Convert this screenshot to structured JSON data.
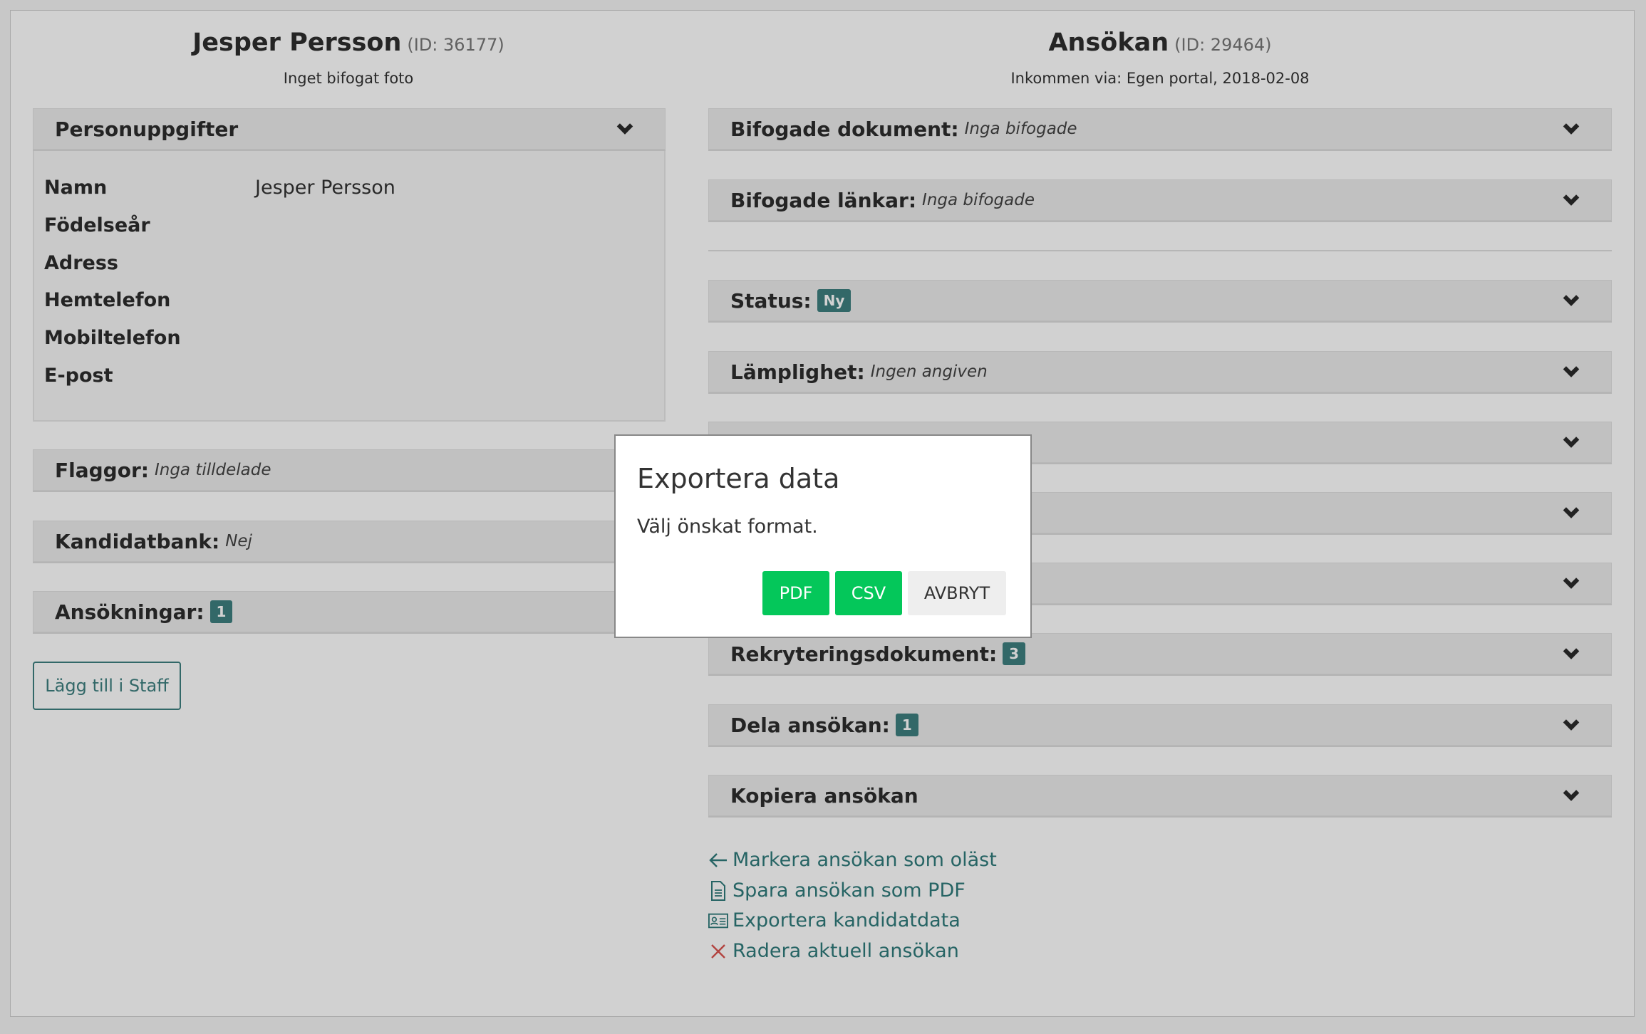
{
  "candidate": {
    "name": "Jesper Persson",
    "id": "(ID: 36177)",
    "photo_note": "Inget bifogat foto"
  },
  "personal": {
    "title": "Personuppgifter",
    "fields": [
      {
        "label": "Namn",
        "value": "Jesper Persson"
      },
      {
        "label": "Födelseår",
        "value": ""
      },
      {
        "label": "Adress",
        "value": ""
      },
      {
        "label": "Hemtelefon",
        "value": ""
      },
      {
        "label": "Mobiltelefon",
        "value": ""
      },
      {
        "label": "E-post",
        "value": ""
      }
    ]
  },
  "left_sections": {
    "flags": {
      "label": "Flaggor:",
      "note": "Inga tilldelade"
    },
    "candidate_bank": {
      "label": "Kandidatbank:",
      "note": "Nej"
    },
    "applications": {
      "label": "Ansökningar:",
      "badge": "1"
    }
  },
  "add_staff_button": "Lägg till i Staff",
  "application": {
    "title": "Ansökan",
    "id": "(ID: 29464)",
    "received": "Inkommen via: Egen portal, 2018-02-08"
  },
  "right_sections": {
    "documents": {
      "label": "Bifogade dokument:",
      "note": "Inga bifogade"
    },
    "links": {
      "label": "Bifogade länkar:",
      "note": "Inga bifogade"
    },
    "status": {
      "label": "Status:",
      "badge": "Ny"
    },
    "suitability": {
      "label": "Lämplighet:",
      "note": "Ingen angiven"
    },
    "recruitment_docs": {
      "label": "Rekryteringsdokument:",
      "badge": "3"
    },
    "share": {
      "label": "Dela ansökan:",
      "badge": "1"
    },
    "copy": {
      "label": "Kopiera ansökan"
    }
  },
  "actions": [
    {
      "icon": "arrow-left-icon",
      "label": "Markera ansökan som oläst"
    },
    {
      "icon": "document-icon",
      "label": "Spara ansökan som PDF"
    },
    {
      "icon": "id-card-icon",
      "label": "Exportera kandidatdata"
    },
    {
      "icon": "close-icon",
      "label": "Radera aktuell ansökan"
    }
  ],
  "modal": {
    "title": "Exportera data",
    "message": "Välj önskat format.",
    "buttons": {
      "pdf": "PDF",
      "csv": "CSV",
      "cancel": "AVBRYT"
    }
  },
  "colors": {
    "accent": "#3d7f7f",
    "export_green": "#04c75a",
    "delete_red": "#d9534f"
  }
}
